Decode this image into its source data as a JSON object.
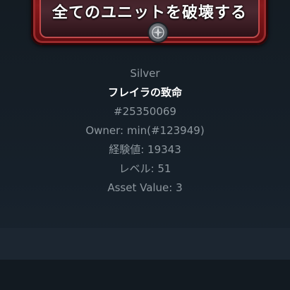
{
  "card": {
    "text": "全てのユニットを破壊する",
    "emblem_icon": "compass-emblem-icon"
  },
  "item": {
    "rarity": "Silver",
    "name": "フレイラの致命",
    "id": "#25350069",
    "owner": "Owner: min(#123949)",
    "experience": "経験値: 19343",
    "level": "レベル: 51",
    "asset_value": "Asset Value: 3"
  }
}
